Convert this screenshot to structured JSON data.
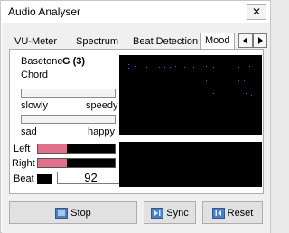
{
  "window": {
    "title": "Audio Analyser",
    "close_glyph": "✕"
  },
  "tabs": [
    {
      "label": "VU-Meter"
    },
    {
      "label": "Spectrum"
    },
    {
      "label": "Beat Detection"
    },
    {
      "label": "Mood",
      "active": true
    }
  ],
  "mood": {
    "basetone_label": "Basetone",
    "basetone_value": "G (3)",
    "chord_label": "Chord",
    "tempo_left": "slowly",
    "tempo_right": "speedy",
    "mood_left": "sad",
    "mood_right": "happy"
  },
  "meters": {
    "left_label": "Left",
    "left_level": 0.38,
    "right_label": "Right",
    "right_level": 0.38,
    "beat_label": "Beat",
    "beat_value": "92"
  },
  "buttons": {
    "stop": "Stop",
    "sync": "Sync",
    "reset": "Reset"
  },
  "colors": {
    "meter_fill": "#e0708c",
    "display_bg": "#000000",
    "display_dots": "#5a5ad6"
  }
}
